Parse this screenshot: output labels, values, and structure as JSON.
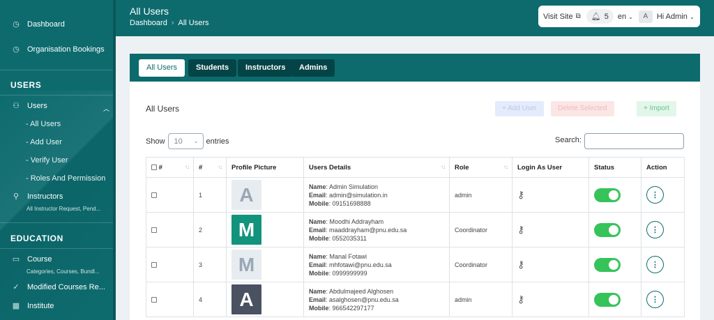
{
  "sidebar": {
    "top_items": [
      {
        "label": "Dashboard",
        "icon": "clock-icon"
      },
      {
        "label": "Organisation Bookings",
        "icon": "clock-icon"
      }
    ],
    "users_section": "USERS",
    "users_item": "Users",
    "users_sub": [
      "- All Users",
      "- Add User",
      "- Verify User",
      "- Roles And Permission"
    ],
    "instructors": {
      "label": "Instructors",
      "sub": "All Instructor Request, Pend..."
    },
    "education_section": "EDUCATION",
    "course": {
      "label": "Course",
      "sub": "Categories, Courses, Bundl..."
    },
    "modified_courses": "Modified Courses Re...",
    "institute": "Institute"
  },
  "header": {
    "title": "All Users",
    "breadcrumb": [
      "Dashboard",
      "All Users"
    ],
    "visit_site": "Visit Site",
    "notif_count": "5",
    "lang": "en",
    "avatar": "A",
    "greeting": "Hi Admin"
  },
  "tabs": [
    "All Users",
    "Students",
    "Instructors",
    "Admins"
  ],
  "card": {
    "title": "All Users",
    "add_user": "+ Add User",
    "delete_selected": "Delete Selected",
    "import": "+ Import",
    "show": "Show",
    "entries_value": "10",
    "entries": "entries",
    "search_label": "Search:"
  },
  "table": {
    "headers": [
      "#",
      "#",
      "Profile Picture",
      "Users Details",
      "Role",
      "Login As User",
      "Status",
      "Action"
    ],
    "rows": [
      {
        "num": "1",
        "initial": "A",
        "color": "#e7ecf1",
        "fg": "#9aa7b4",
        "name": "Admin Simulation",
        "email": "admin@simulation.in",
        "mobile": "09151698888",
        "role": "admin"
      },
      {
        "num": "2",
        "initial": "M",
        "color": "#11937c",
        "fg": "#ffffff",
        "name": "Moodhi Addrayham",
        "email": "maaddrayham@pnu.edu.sa",
        "mobile": "0552035311",
        "role": "Coordinator"
      },
      {
        "num": "3",
        "initial": "M",
        "color": "#e7ecf1",
        "fg": "#9aa7b4",
        "name": "Manal Fotawi",
        "email": "mhfotawi@pnu.edu.sa",
        "mobile": "0999999999",
        "role": "Coordinator"
      },
      {
        "num": "4",
        "initial": "A",
        "color": "#4a5160",
        "fg": "#ffffff",
        "name": "Abdulmajeed Alghosen",
        "email": "asalghosen@pnu.edu.sa",
        "mobile": "966542297177",
        "role": "admin"
      }
    ],
    "labels": {
      "name": "Name",
      "email": "Email",
      "mobile": "Mobile"
    }
  }
}
